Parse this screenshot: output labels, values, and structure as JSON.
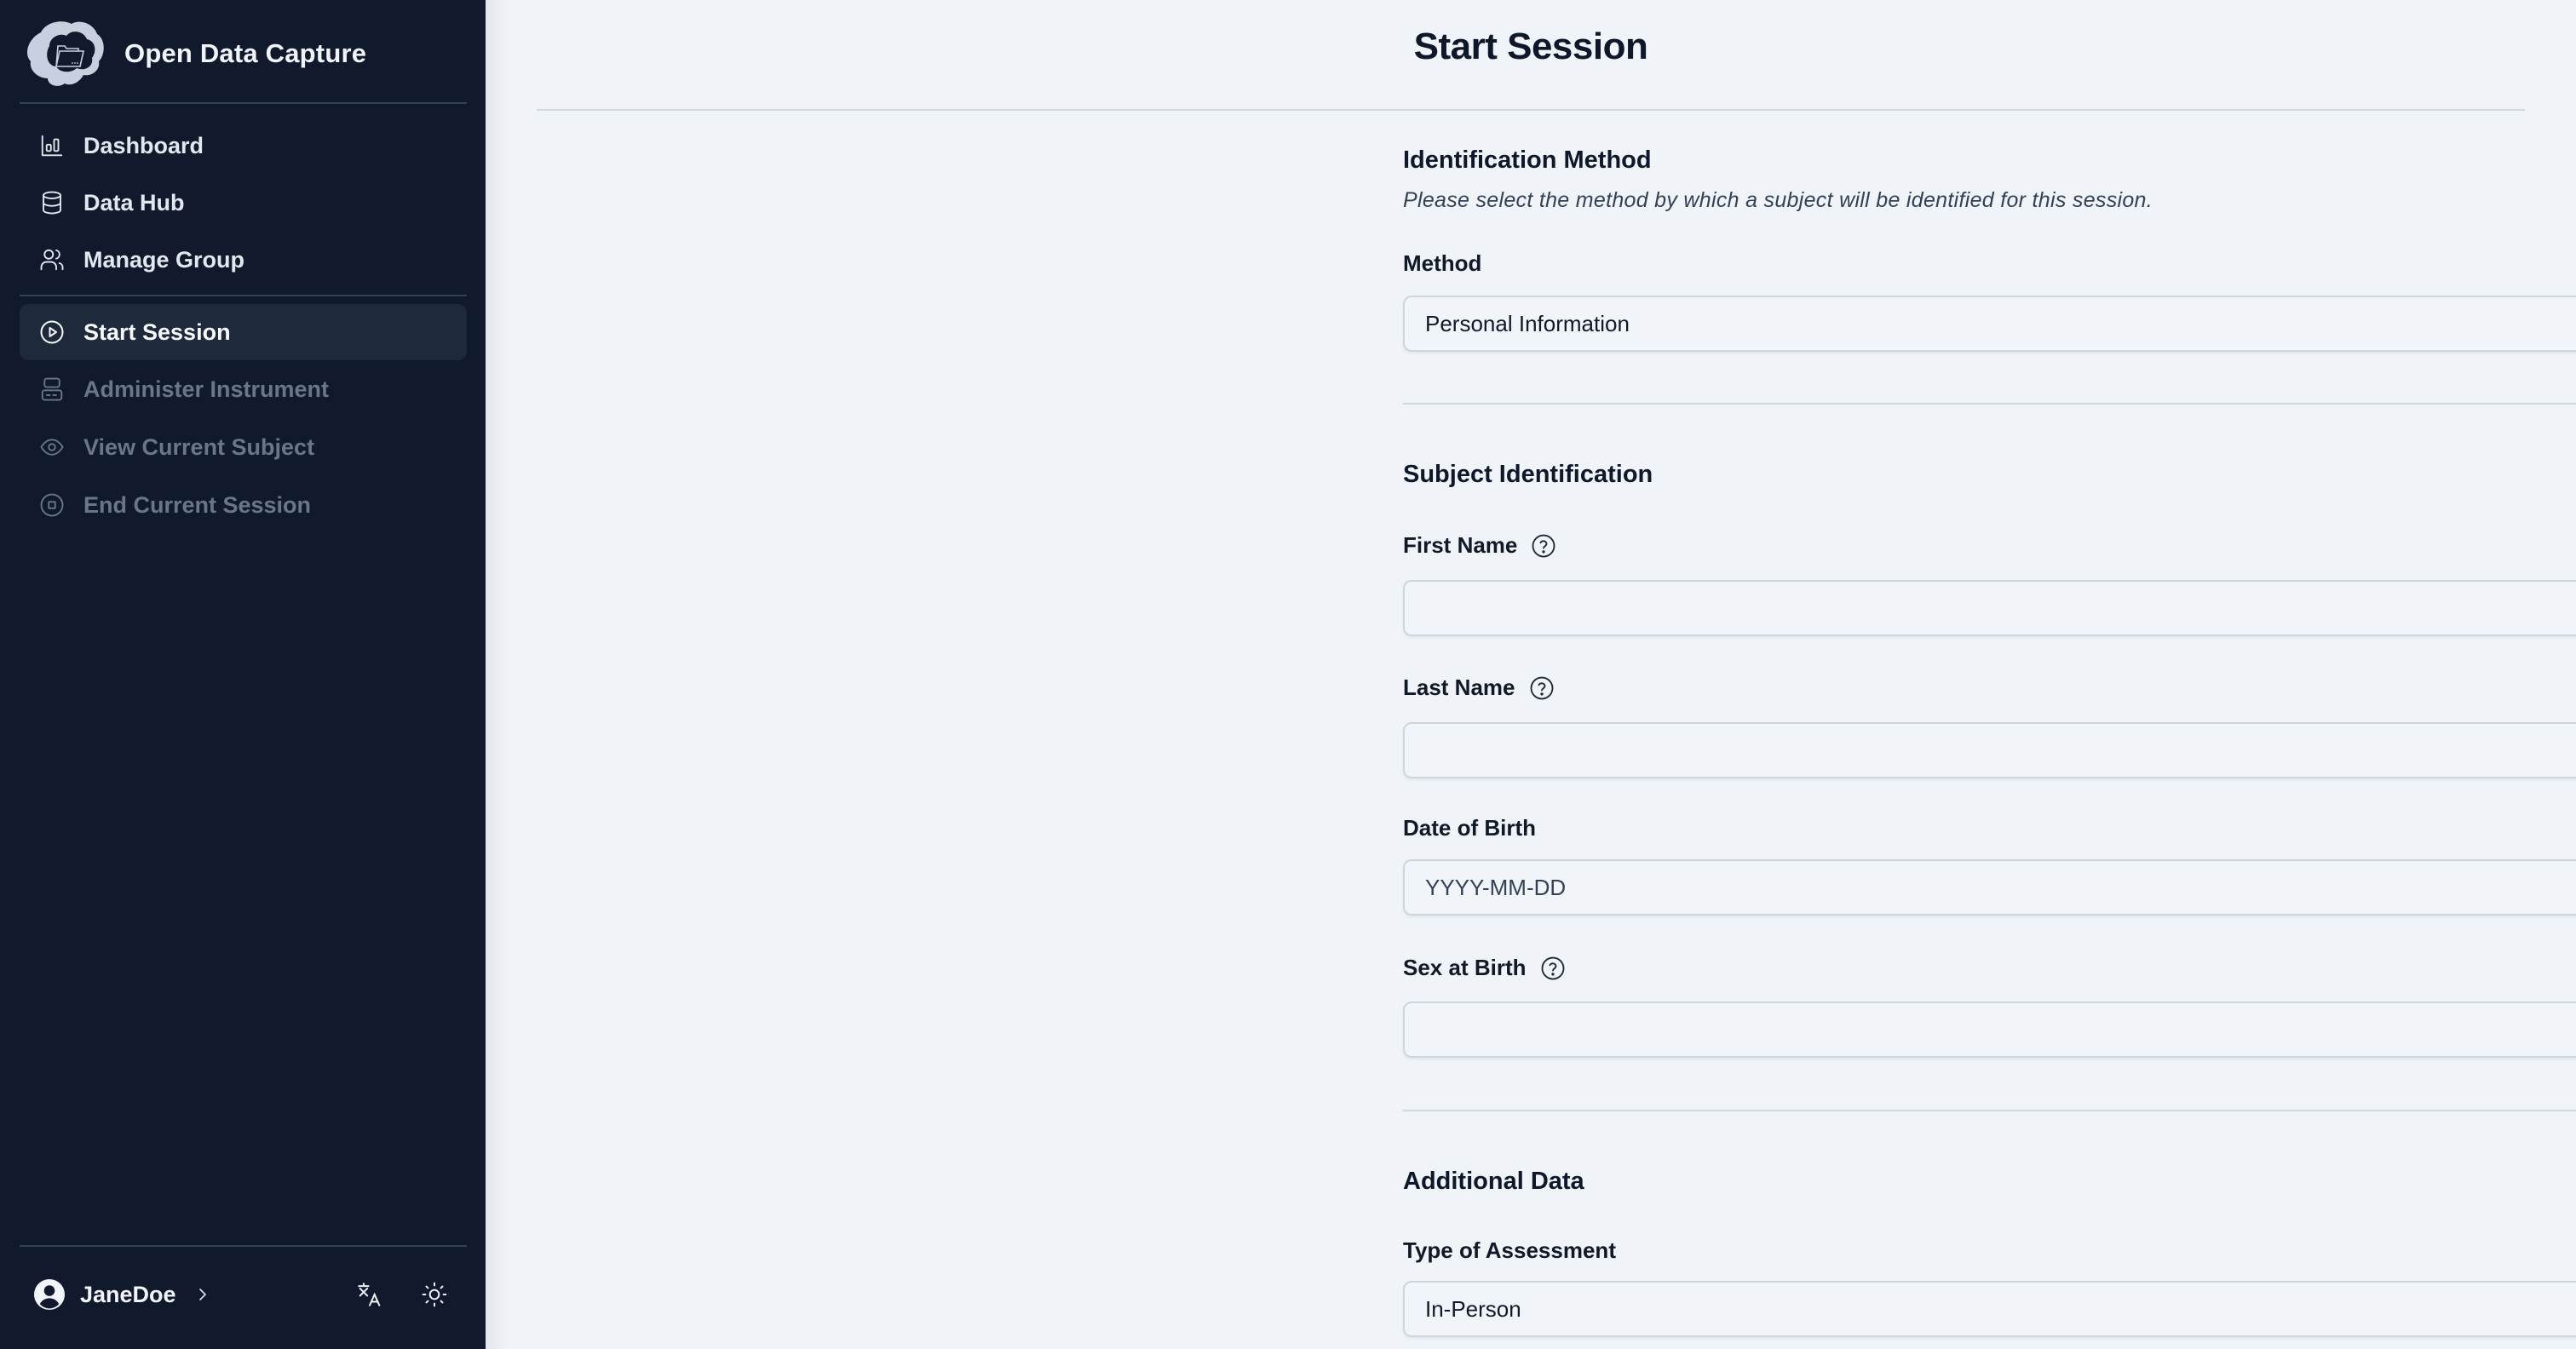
{
  "app": {
    "name": "Open Data Capture",
    "logo_icon": "brain-cloud-folder-logo"
  },
  "sidebar": {
    "main_items": [
      {
        "label": "Dashboard",
        "icon": "bar-chart-icon",
        "state": "normal"
      },
      {
        "label": "Data Hub",
        "icon": "database-icon",
        "state": "normal"
      },
      {
        "label": "Manage Group",
        "icon": "users-icon",
        "state": "normal"
      }
    ],
    "session_items": [
      {
        "label": "Start Session",
        "icon": "play-circle-icon",
        "state": "active"
      },
      {
        "label": "Administer Instrument",
        "icon": "instrument-icon",
        "state": "disabled"
      },
      {
        "label": "View Current Subject",
        "icon": "eye-icon",
        "state": "disabled"
      },
      {
        "label": "End Current Session",
        "icon": "stop-circle-icon",
        "state": "disabled"
      }
    ],
    "footer": {
      "username": "JaneDoe",
      "user_icon": "user-circle-icon",
      "chevron_icon": "chevron-right-icon",
      "language_icon": "translate-icon",
      "theme_icon": "sun-icon"
    }
  },
  "page": {
    "title": "Start Session"
  },
  "form": {
    "identification": {
      "title": "Identification Method",
      "description": "Please select the method by which a subject will be identified for this session.",
      "method_label": "Method",
      "method_value": "Personal Information"
    },
    "subject": {
      "title": "Subject Identification",
      "first_name_label": "First Name",
      "first_name_value": "",
      "last_name_label": "Last Name",
      "last_name_value": "",
      "dob_label": "Date of Birth",
      "dob_placeholder": "YYYY-MM-DD",
      "sex_label": "Sex at Birth",
      "sex_value": ""
    },
    "additional": {
      "title": "Additional Data",
      "assessment_label": "Type of Assessment",
      "assessment_value": "In-Person"
    }
  },
  "colors": {
    "sidebar_bg": "#111a2d",
    "sidebar_active_bg": "#1e293b",
    "main_bg": "#f0f4f8",
    "text_primary": "#0f172a",
    "disabled_text": "#6b7789"
  }
}
